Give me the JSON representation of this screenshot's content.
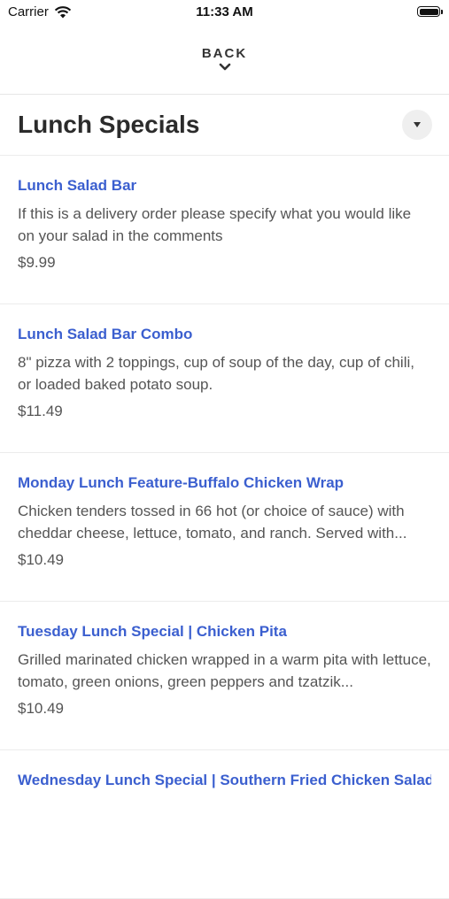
{
  "status_bar": {
    "carrier": "Carrier",
    "time": "11:33 AM"
  },
  "nav": {
    "back_label": "BACK"
  },
  "section": {
    "title": "Lunch Specials"
  },
  "items": [
    {
      "name": "Lunch Salad Bar",
      "description": "If this is a delivery order please specify what you would like on your salad in the comments",
      "price": "$9.99"
    },
    {
      "name": "Lunch Salad Bar Combo",
      "description": "8\" pizza with 2 toppings, cup of soup of the day, cup of chili, or loaded baked potato soup.",
      "price": "$11.49"
    },
    {
      "name": "Monday Lunch Feature-Buffalo Chicken Wrap",
      "description": "Chicken tenders tossed in 66 hot (or choice of sauce) with cheddar cheese, lettuce, tomato, and ranch. Served with...",
      "price": "$10.49"
    },
    {
      "name": "Tuesday Lunch Special | Chicken Pita",
      "description": "Grilled marinated chicken wrapped in a warm pita with lettuce, tomato, green onions, green peppers and tzatzik...",
      "price": "$10.49"
    },
    {
      "name": "Wednesday Lunch Special | Southern Fried Chicken Salad",
      "description": "",
      "price": ""
    }
  ],
  "colors": {
    "item_name": "#3b5fcf",
    "text_secondary": "#555555",
    "divider": "#ececec"
  },
  "icons": {
    "back": "chevron-down-icon",
    "collapse": "caret-down-icon",
    "wifi": "wifi-icon",
    "battery": "battery-icon"
  }
}
